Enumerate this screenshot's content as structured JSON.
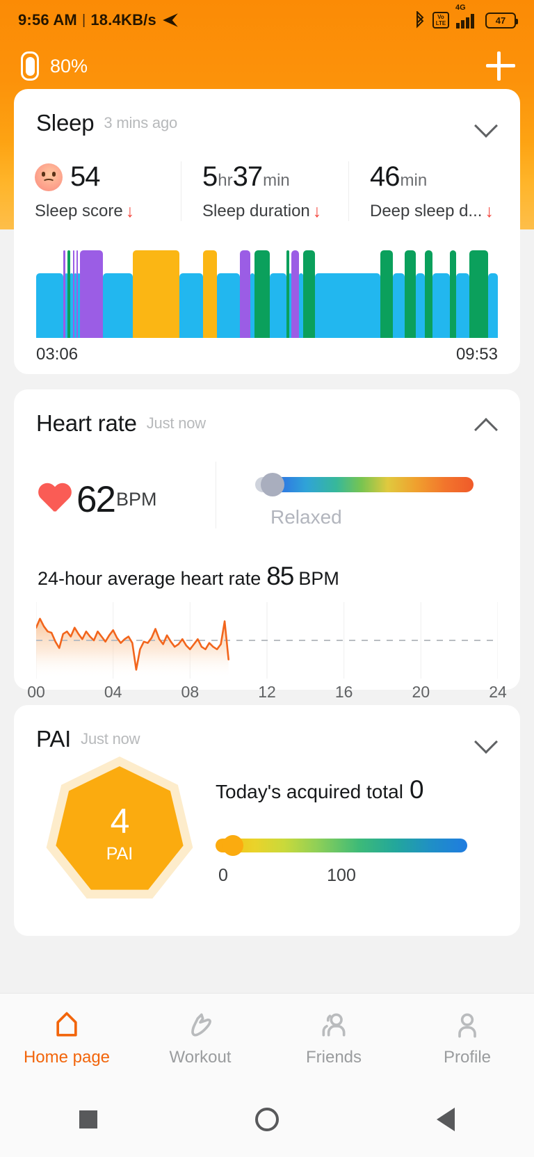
{
  "status_bar": {
    "time": "9:56 AM",
    "separator": "|",
    "network_speed": "18.4KB/s",
    "telegram_icon": "send-icon",
    "bluetooth_icon": "bluetooth-icon",
    "volte_top": "Vo",
    "volte_bottom": "LTE",
    "network_type": "4G",
    "battery_level": "47"
  },
  "header": {
    "band_battery": "80%",
    "add_label": "+"
  },
  "sleep": {
    "title": "Sleep",
    "time_ago": "3 mins ago",
    "chevron": "chevron-down-icon",
    "stats": [
      {
        "value": "54",
        "unit": "",
        "label": "Sleep score",
        "trend": "↓",
        "emoji": "sad-face-icon"
      },
      {
        "value": "5",
        "unit": "hr",
        "value2": "37",
        "unit2": "min",
        "label": "Sleep duration",
        "trend": "↓"
      },
      {
        "value": "46",
        "unit": "min",
        "label": "Deep sleep d...",
        "trend": "↓"
      }
    ],
    "start_time": "03:06",
    "end_time": "09:53",
    "legend_colors": {
      "awake": "#22b7ef",
      "light": "#fbb614",
      "deep": "#0ba05c",
      "rem": "#9b5de5"
    }
  },
  "heart_rate": {
    "title": "Heart rate",
    "time_ago": "Just now",
    "chevron": "chevron-up-icon",
    "bpm": "62",
    "bpm_unit": "BPM",
    "state": "Relaxed",
    "avg_prefix": "24-hour average heart rate",
    "avg_value": "85",
    "avg_unit": "BPM"
  },
  "pai": {
    "title": "PAI",
    "time_ago": "Just now",
    "chevron": "chevron-down-icon",
    "score": "4",
    "score_label": "PAI",
    "total_label": "Today's acquired total",
    "total_value": "0",
    "scale_min": "0",
    "scale_max": "100"
  },
  "bottom_nav": {
    "items": [
      {
        "label": "Home page",
        "icon": "home-icon",
        "active": true
      },
      {
        "label": "Workout",
        "icon": "shoe-icon",
        "active": false
      },
      {
        "label": "Friends",
        "icon": "friends-icon",
        "active": false
      },
      {
        "label": "Profile",
        "icon": "profile-icon",
        "active": false
      }
    ]
  },
  "system_nav": {
    "recents": "square-icon",
    "home": "circle-icon",
    "back": "triangle-back-icon"
  },
  "chart_data": [
    {
      "type": "bar",
      "name": "sleep-stages",
      "title": "Sleep stages",
      "xlabel": "",
      "ylabel": "",
      "x_start": "03:06",
      "x_end": "09:53",
      "stage_colors": {
        "awake": "#22b7ef",
        "light": "#fbb614",
        "deep": "#0ba05c",
        "rem": "#9b5de5"
      },
      "segments": [
        {
          "stage": "awake",
          "start": 0.0,
          "width": 0.085
        },
        {
          "stage": "rem",
          "start": 0.085,
          "width": 0.006
        },
        {
          "stage": "awake",
          "start": 0.091,
          "width": 0.007
        },
        {
          "stage": "deep",
          "start": 0.098,
          "width": 0.009
        },
        {
          "stage": "awake",
          "start": 0.107,
          "width": 0.008
        },
        {
          "stage": "rem",
          "start": 0.115,
          "width": 0.005
        },
        {
          "stage": "awake",
          "start": 0.12,
          "width": 0.005
        },
        {
          "stage": "rem",
          "start": 0.125,
          "width": 0.005
        },
        {
          "stage": "awake",
          "start": 0.13,
          "width": 0.006
        },
        {
          "stage": "rem",
          "start": 0.136,
          "width": 0.072
        },
        {
          "stage": "awake",
          "start": 0.208,
          "width": 0.093
        },
        {
          "stage": "light",
          "start": 0.301,
          "width": 0.147
        },
        {
          "stage": "awake",
          "start": 0.448,
          "width": 0.073
        },
        {
          "stage": "light",
          "start": 0.521,
          "width": 0.043
        },
        {
          "stage": "awake",
          "start": 0.564,
          "width": 0.072
        },
        {
          "stage": "rem",
          "start": 0.636,
          "width": 0.033
        },
        {
          "stage": "awake",
          "start": 0.669,
          "width": 0.013
        },
        {
          "stage": "deep",
          "start": 0.682,
          "width": 0.047
        },
        {
          "stage": "awake",
          "start": 0.729,
          "width": 0.052
        },
        {
          "stage": "deep",
          "start": 0.781,
          "width": 0.01
        },
        {
          "stage": "awake",
          "start": 0.791,
          "width": 0.006
        },
        {
          "stage": "rem",
          "start": 0.797,
          "width": 0.024
        },
        {
          "stage": "awake",
          "start": 0.821,
          "width": 0.014
        },
        {
          "stage": "deep",
          "start": 0.835,
          "width": 0.035
        },
        {
          "stage": "awake",
          "start": 0.87,
          "width": 0.205
        },
        {
          "stage": "deep",
          "start": 1.075,
          "width": 0.04
        },
        {
          "stage": "awake",
          "start": 1.115,
          "width": 0.035
        },
        {
          "stage": "deep",
          "start": 1.15,
          "width": 0.035
        },
        {
          "stage": "awake",
          "start": 1.185,
          "width": 0.03
        },
        {
          "stage": "deep",
          "start": 1.215,
          "width": 0.022
        },
        {
          "stage": "awake",
          "start": 1.237,
          "width": 0.055
        },
        {
          "stage": "deep",
          "start": 1.292,
          "width": 0.02
        },
        {
          "stage": "awake",
          "start": 1.312,
          "width": 0.04
        },
        {
          "stage": "deep",
          "start": 1.352,
          "width": 0.06
        },
        {
          "stage": "awake",
          "start": 1.412,
          "width": 0.03
        }
      ]
    },
    {
      "type": "area",
      "name": "heart-rate-24h",
      "title": "24-hour average heart rate 85 BPM",
      "xlabel": "",
      "ylabel": "BPM",
      "line_color": "#f2651c",
      "average": 85,
      "average_line": "dashed",
      "xticks": [
        "00",
        "04",
        "08",
        "12",
        "16",
        "20",
        "24"
      ],
      "xlim": [
        0,
        24
      ],
      "ylim": [
        55,
        115
      ],
      "x": [
        0.0,
        0.2,
        0.4,
        0.6,
        0.8,
        1.0,
        1.2,
        1.4,
        1.6,
        1.8,
        2.0,
        2.2,
        2.4,
        2.6,
        2.8,
        3.0,
        3.2,
        3.4,
        3.6,
        3.8,
        4.0,
        4.2,
        4.4,
        4.6,
        4.8,
        5.0,
        5.2,
        5.4,
        5.6,
        5.8,
        6.0,
        6.2,
        6.4,
        6.6,
        6.8,
        7.0,
        7.2,
        7.4,
        7.6,
        7.8,
        8.0,
        8.2,
        8.4,
        8.6,
        8.8,
        9.0,
        9.2,
        9.4,
        9.6,
        9.8,
        10.0
      ],
      "values": [
        95,
        102,
        96,
        92,
        91,
        84,
        79,
        90,
        92,
        88,
        95,
        90,
        86,
        92,
        88,
        85,
        92,
        88,
        84,
        89,
        93,
        87,
        83,
        86,
        88,
        83,
        62,
        78,
        84,
        83,
        87,
        94,
        86,
        82,
        89,
        84,
        80,
        82,
        86,
        81,
        78,
        82,
        86,
        80,
        78,
        83,
        80,
        78,
        82,
        100,
        70
      ]
    },
    {
      "type": "gauge",
      "name": "heart-rate-zone",
      "title": "Heart rate zone",
      "value": 62,
      "state": "Relaxed",
      "position_pct": 2
    },
    {
      "type": "gauge",
      "name": "pai-progress",
      "title": "PAI progress",
      "value": 4,
      "min": 0,
      "max": 100,
      "position_pct": 4
    }
  ]
}
